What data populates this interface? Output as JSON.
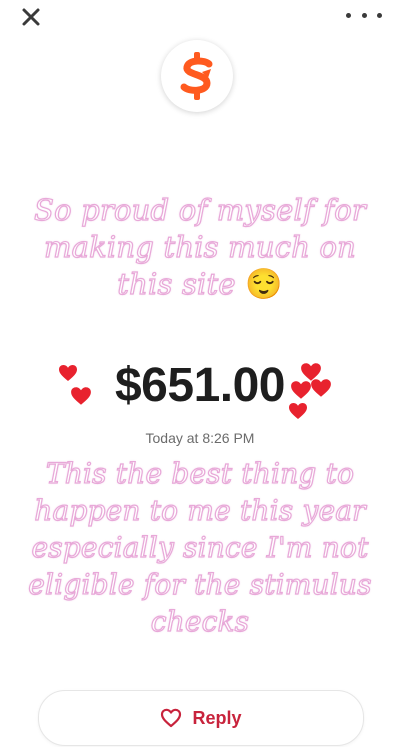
{
  "colors": {
    "brand_orange": "#ff5a1f",
    "reply_red": "#c8233c",
    "caption_outline": "#e8a8d8",
    "heart_red": "#e8222e"
  },
  "icons": {
    "close": "close-icon",
    "more": "more-options-icon",
    "logo": "dollar-sign-icon",
    "reply": "heart-outline-icon",
    "decoration": "red-heart-icon"
  },
  "caption_top": {
    "text": "So proud of myself for making this much on this site",
    "emoji": "😌"
  },
  "payment": {
    "amount": "$651.00",
    "timestamp": "Today at 8:26 PM"
  },
  "caption_bottom": {
    "text": "This the best thing to happen to me this year especially since I'm not eligible for the stimulus checks"
  },
  "reply": {
    "label": "Reply"
  }
}
